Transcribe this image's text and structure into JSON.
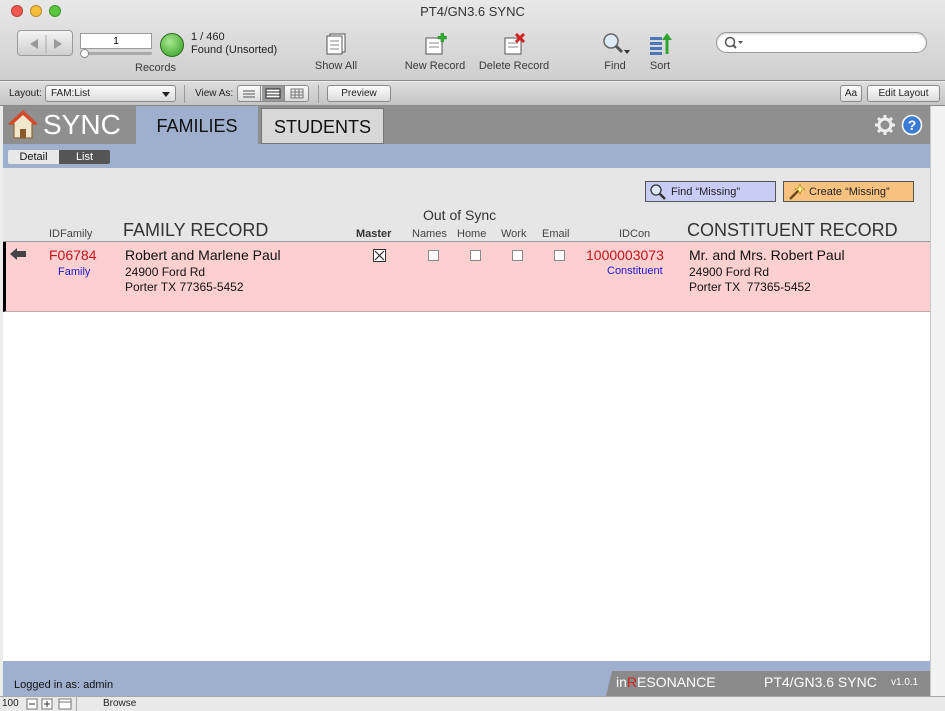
{
  "window": {
    "title": "PT4/GN3.6 SYNC"
  },
  "toolbar": {
    "record_input": "1",
    "record_count": "1 / 460",
    "found_status": "Found (Unsorted)",
    "records_label": "Records",
    "show_all": "Show All",
    "new_record": "New Record",
    "delete_record": "Delete Record",
    "find": "Find",
    "sort": "Sort"
  },
  "layout_bar": {
    "layout_label": "Layout:",
    "layout_value": "FAM:List",
    "view_as_label": "View As:",
    "preview": "Preview",
    "aa": "Aa",
    "edit_layout": "Edit Layout"
  },
  "app": {
    "brand": "SYNC",
    "tabs": [
      "FAMILIES",
      "STUDENTS"
    ],
    "active_tab": "FAMILIES",
    "subtabs": [
      "Detail",
      "List"
    ],
    "active_subtab": "List"
  },
  "actions": {
    "find_missing": "Find “Missing”",
    "create_missing": "Create “Missing”"
  },
  "columns": {
    "id_family": "IDFamily",
    "family_record": "FAMILY RECORD",
    "out_of_sync": "Out of Sync",
    "master": "Master",
    "names": "Names",
    "home": "Home",
    "work": "Work",
    "email": "Email",
    "id_con": "IDCon",
    "constituent_record": "CONSTITUENT RECORD"
  },
  "rows": [
    {
      "id_family": "F06784",
      "family_type": "Family",
      "family_name": "Robert and Marlene Paul",
      "family_addr1": "24900 Ford Rd",
      "family_addr2": "Porter TX 77365-5452",
      "master_checked": true,
      "id_con": "1000003073",
      "con_type": "Constituent",
      "con_name": "Mr. and Mrs. Robert Paul",
      "con_addr1": "24900 Ford Rd",
      "con_addr2": "Porter TX  77365-5452"
    }
  ],
  "footer": {
    "logged_in": "Logged in as: admin",
    "brand_in": "in",
    "brand_r": "R",
    "brand_rest": "ESONANCE",
    "app_name": "PT4/GN3.6 SYNC",
    "version": "v1.0.1"
  },
  "statusbar": {
    "zoom": "100",
    "mode": "Browse"
  },
  "colors": {
    "row_bg": "#fcd0d0",
    "id_red": "#c0141c",
    "link_blue": "#1a1acd",
    "tab_active": "#9fb0cf",
    "find_btn": "#c9cdf6",
    "create_btn": "#f7c27f"
  }
}
